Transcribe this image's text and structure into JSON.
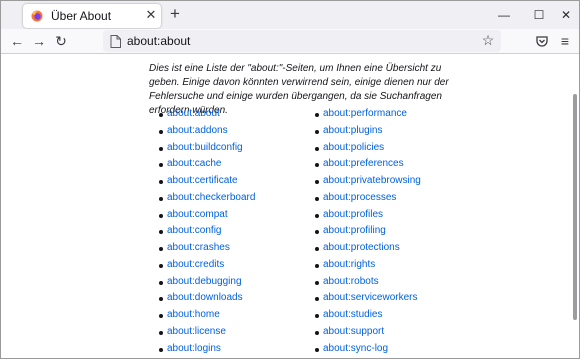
{
  "tab": {
    "title": "Über About",
    "close_label": "✕",
    "new_tab_label": "+"
  },
  "window_controls": {
    "minimize": "—",
    "maximize": "☐",
    "close": "✕"
  },
  "nav": {
    "back": "←",
    "forward": "→",
    "reload": "↻",
    "star": "☆",
    "menu": "≡"
  },
  "urlbar": {
    "text": "about:about"
  },
  "page": {
    "intro": "Dies ist eine Liste der \"about:\"-Seiten, um Ihnen eine Übersicht zu geben. Einige davon könnten verwirrend sein, einige dienen nur der Fehlersuche und einige wurden übergangen, da sie Suchanfragen erfordern würden.",
    "left_links": [
      "about:about",
      "about:addons",
      "about:buildconfig",
      "about:cache",
      "about:certificate",
      "about:checkerboard",
      "about:compat",
      "about:config",
      "about:crashes",
      "about:credits",
      "about:debugging",
      "about:downloads",
      "about:home",
      "about:license",
      "about:logins"
    ],
    "right_links": [
      "about:performance",
      "about:plugins",
      "about:policies",
      "about:preferences",
      "about:privatebrowsing",
      "about:processes",
      "about:profiles",
      "about:profiling",
      "about:protections",
      "about:rights",
      "about:robots",
      "about:serviceworkers",
      "about:studies",
      "about:support",
      "about:sync-log"
    ]
  },
  "colors": {
    "link": "#0061e0",
    "chrome": "#f0f0f4",
    "content_bg": "#ffffff"
  }
}
